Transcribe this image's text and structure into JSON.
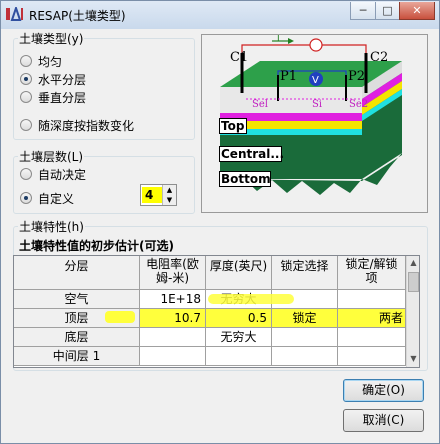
{
  "window": {
    "title": "RESAP(土壤类型)"
  },
  "soil_type": {
    "label": "土壤类型(y)",
    "options": [
      "均匀",
      "水平分层",
      "垂直分层",
      "随深度按指数变化"
    ],
    "selected": "水平分层"
  },
  "diagram": {
    "c1": "C1",
    "c2": "C2",
    "p1": "P1",
    "p2": "P2",
    "i_label": "I",
    "v_label": "V",
    "sel_label": "Sel",
    "si_label": "Si",
    "sel2_label": "Se2",
    "layer_top": "Top",
    "layer_central": "Central...",
    "layer_bottom": "Bottom",
    "colors": {
      "top": "#e8e8e8",
      "magenta": "#e020e0",
      "yellow": "#f5e400",
      "cyan": "#20e0e0",
      "green": "#1a6b3a"
    }
  },
  "soil_layers": {
    "label": "土壤层数(L)",
    "options": [
      "自动决定",
      "自定义"
    ],
    "selected": "自定义",
    "custom_count": "4"
  },
  "soil_props": {
    "label": "土壤特性(h)",
    "subtitle": "土壤特性值的初步估计(可选)",
    "columns": {
      "layer": "分层",
      "resistivity": "电阻率(欧姆-米)",
      "thickness": "厚度(英尺)",
      "lock": "锁定选择",
      "unlock": "锁定/解锁项"
    },
    "rows": [
      {
        "layer": "空气",
        "resistivity": "1E+18",
        "thickness": "无穷大",
        "lock": "",
        "unlock": ""
      },
      {
        "layer": "顶层",
        "resistivity": "10.7",
        "thickness": "0.5",
        "lock": "锁定",
        "unlock": "两者"
      },
      {
        "layer": "底层",
        "resistivity": "",
        "thickness": "无穷大",
        "lock": "",
        "unlock": ""
      },
      {
        "layer": "中间层 1",
        "resistivity": "",
        "thickness": "",
        "lock": "",
        "unlock": ""
      }
    ],
    "highlight_color": "#ffff3c"
  },
  "buttons": {
    "ok": "确定(O)",
    "cancel": "取消(C)"
  }
}
